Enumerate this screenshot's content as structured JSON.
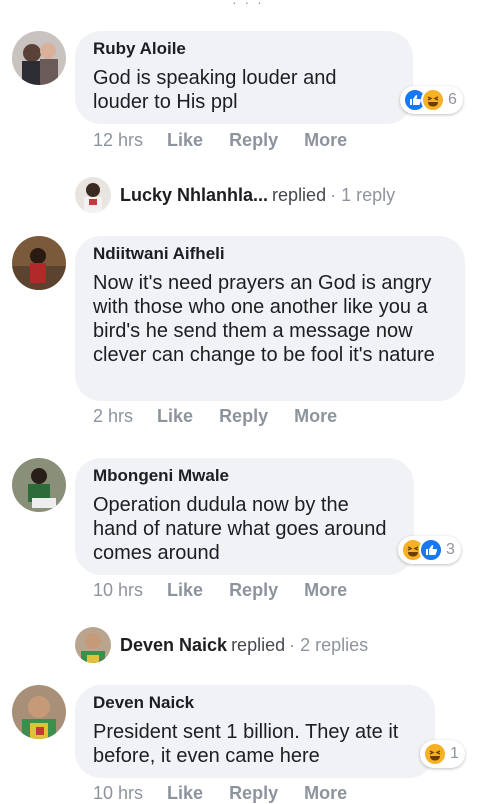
{
  "top_indicator": "· · ·",
  "comments": [
    {
      "author": "Ruby Aloile",
      "text": "God is speaking louder and loudér to His ppl",
      "time": "12 hrs",
      "like": "Like",
      "reply": "Reply",
      "more": "More",
      "reaction_count": "6",
      "reactions": [
        "like-icon",
        "haha-icon"
      ]
    },
    {
      "author": "Ndiitwani Aifheli",
      "text": "Now it's need prayers an God is angry with those who one another like you a bird's he send them a message now clever can change to be fool it's nature",
      "time": "2 hrs",
      "like": "Like",
      "reply": "Reply",
      "more": "More"
    },
    {
      "author": "Mbongeni Mwale",
      "text": "Operation dudula now by the hand of nature what goes around comes around",
      "time": "10 hrs",
      "like": "Like",
      "reply": "Reply",
      "more": "More",
      "reaction_count": "3",
      "reactions": [
        "haha-icon",
        "like-icon"
      ]
    },
    {
      "author": "Deven Naick",
      "text": "President sent 1 billion. They ate it before, it even came here",
      "time": "10 hrs",
      "like": "Like",
      "reply": "Reply",
      "more": "More",
      "reaction_count": "1",
      "reactions": [
        "haha-icon"
      ]
    }
  ],
  "replies": [
    {
      "name": "Lucky Nhlanhla...",
      "word": "replied",
      "count": "· 1 reply"
    },
    {
      "name": "Deven Naick",
      "word": "replied",
      "count": "· 2 replies"
    }
  ],
  "colors": {
    "bubble": "#f0f2f5",
    "meta": "#8d949e",
    "like_blue": "#1877f2",
    "haha_yellow": "#f7b125"
  }
}
